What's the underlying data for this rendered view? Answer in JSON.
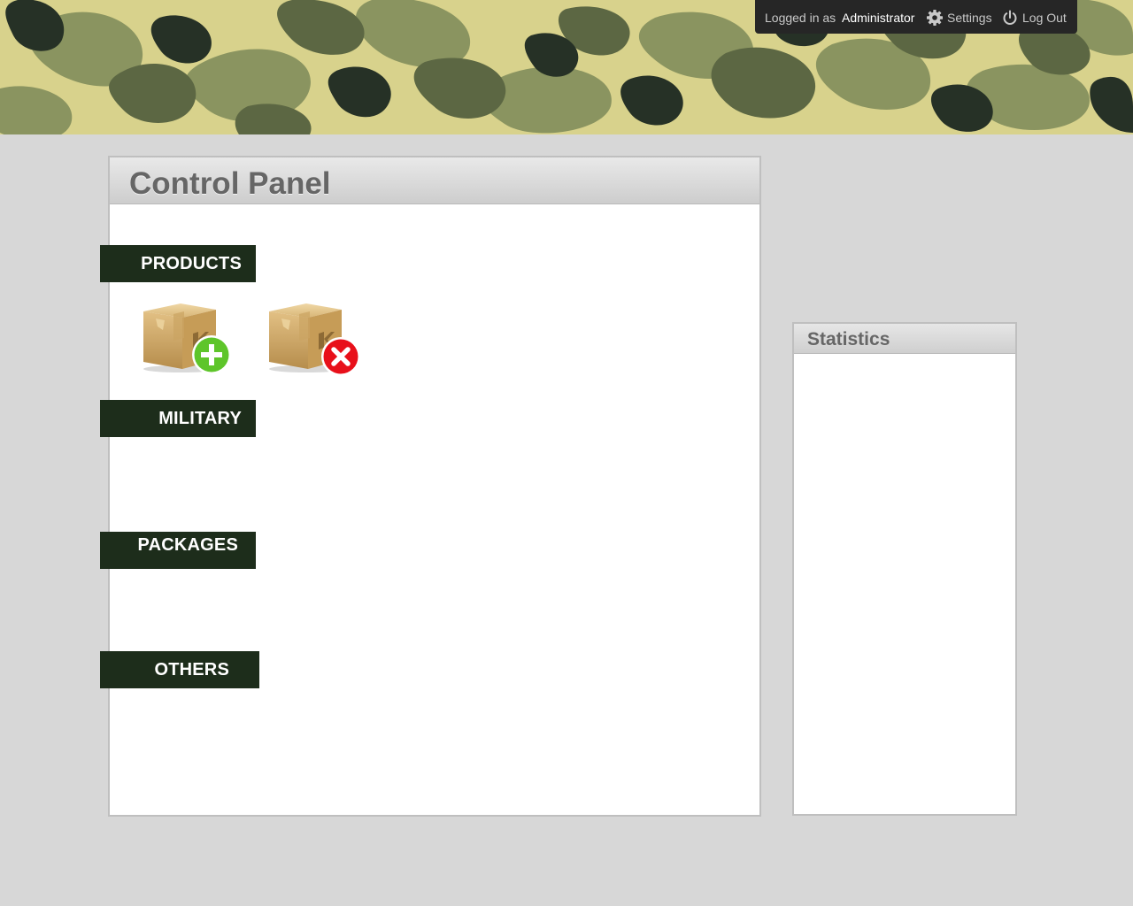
{
  "header": {
    "logged_in_label": "Logged in as",
    "username": "Administrator",
    "settings_label": "Settings",
    "logout_label": "Log Out",
    "settings_icon": "gear-icon",
    "logout_icon": "power-icon",
    "camo_colors": [
      "#d8d28c",
      "#8a9460",
      "#5c6743",
      "#263126"
    ]
  },
  "control_panel": {
    "title": "Control Panel",
    "sections": [
      {
        "label": "PRODUCTS"
      },
      {
        "label": "MILITARY"
      },
      {
        "label": "PACKAGES"
      },
      {
        "label": "OTHERS"
      }
    ],
    "products_actions": [
      {
        "icon": "package-add-icon",
        "badge_color": "#5ec52a"
      },
      {
        "icon": "package-remove-icon",
        "badge_color": "#e8101a"
      }
    ]
  },
  "statistics": {
    "title": "Statistics"
  },
  "colors": {
    "page_bg": "#d7d7d7",
    "section_tab_bg": "#1d2d1b",
    "userbar_bg": "#262626"
  }
}
